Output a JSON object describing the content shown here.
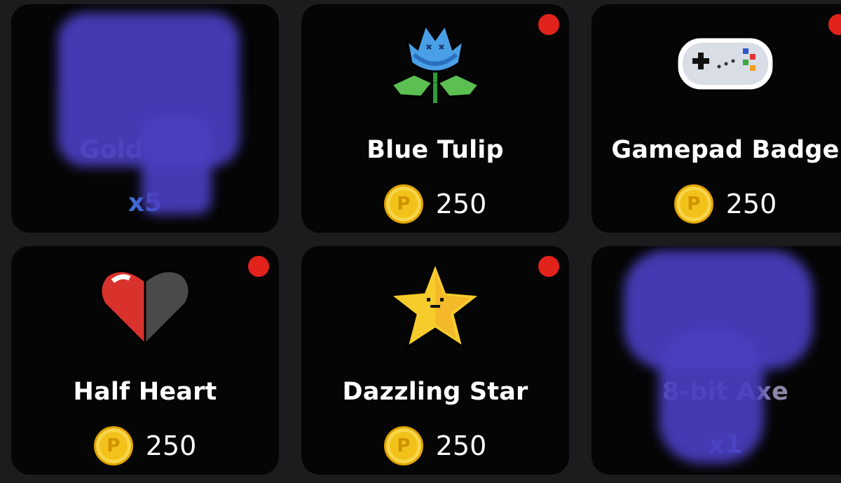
{
  "items": [
    {
      "name": "Gold Star",
      "quantity": "x5",
      "owned": true,
      "new": false,
      "icon": "gold-star-icon"
    },
    {
      "name": "Blue Tulip",
      "price": "250",
      "currency_symbol": "P",
      "new": true,
      "icon": "blue-tulip-icon"
    },
    {
      "name": "Gamepad Badge",
      "price": "250",
      "currency_symbol": "P",
      "new": true,
      "icon": "gamepad-icon"
    },
    {
      "name": "Half Heart",
      "price": "250",
      "currency_symbol": "P",
      "new": true,
      "icon": "half-heart-icon"
    },
    {
      "name": "Dazzling Star",
      "price": "250",
      "currency_symbol": "P",
      "new": true,
      "icon": "dazzling-star-icon"
    },
    {
      "name": "8-bit Axe",
      "quantity": "x1",
      "owned": true,
      "new": false,
      "icon": "axe-icon"
    }
  ],
  "colors": {
    "background": "#1c1c1e",
    "card": "#050505",
    "new_dot": "#e2231b",
    "quantity_text": "#3f6fd8",
    "coin": "#f2c21b",
    "blur_overlay": "#4a3fc0"
  }
}
